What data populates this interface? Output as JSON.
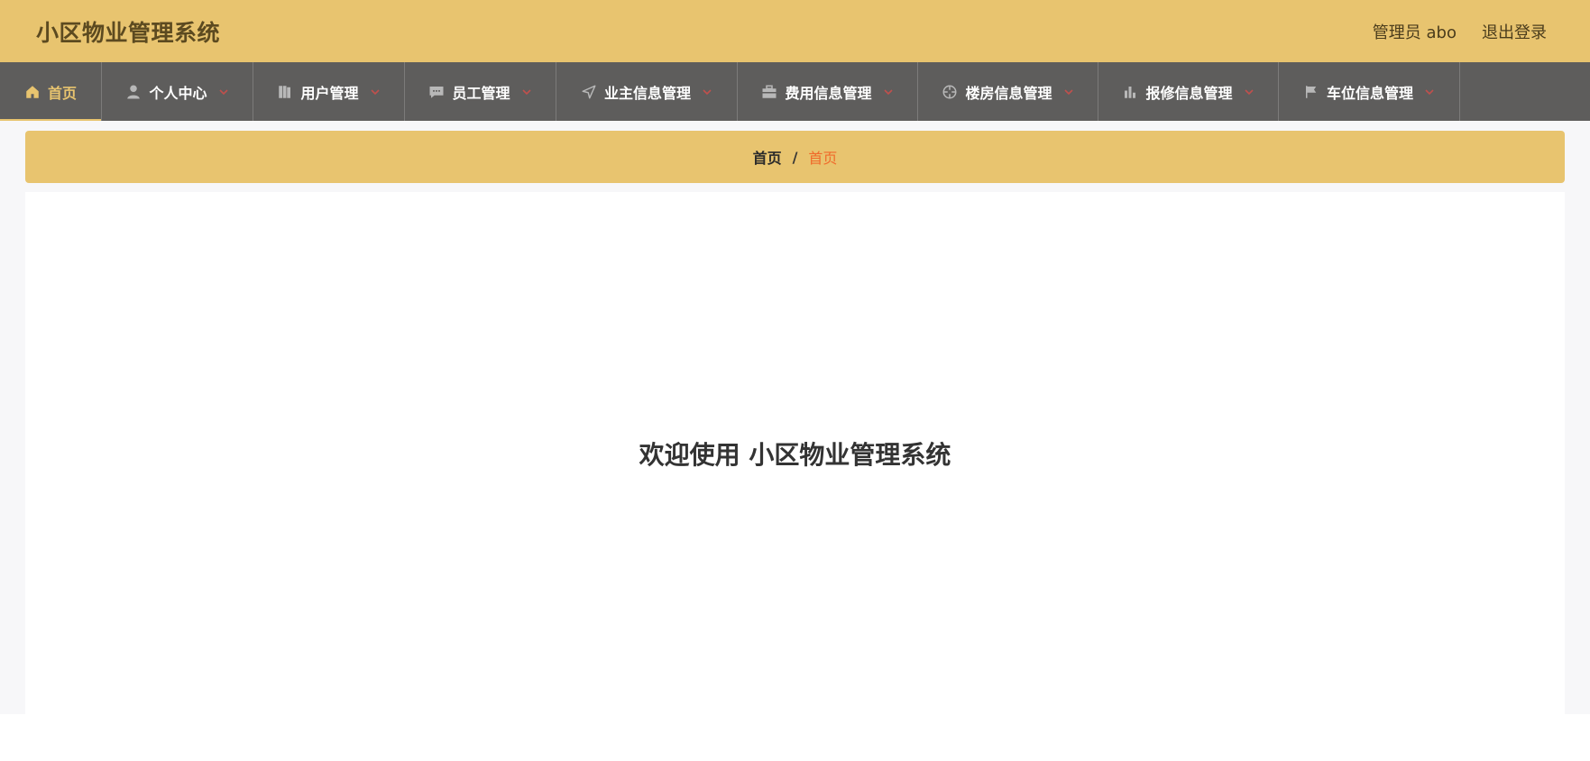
{
  "header": {
    "app_title": "小区物业管理系统",
    "user_label": "管理员 abo",
    "logout_label": "退出登录"
  },
  "nav": {
    "items": [
      {
        "label": "首页",
        "icon": "home-icon",
        "active": true
      },
      {
        "label": "个人中心",
        "icon": "user-icon"
      },
      {
        "label": "用户管理",
        "icon": "book-icon"
      },
      {
        "label": "员工管理",
        "icon": "chat-icon"
      },
      {
        "label": "业主信息管理",
        "icon": "navigation-icon"
      },
      {
        "label": "费用信息管理",
        "icon": "briefcase-icon"
      },
      {
        "label": "楼房信息管理",
        "icon": "crosshair-icon"
      },
      {
        "label": "报修信息管理",
        "icon": "bar-chart-icon"
      },
      {
        "label": "车位信息管理",
        "icon": "flag-icon"
      }
    ]
  },
  "breadcrumb": {
    "home": "首页",
    "separator": "/",
    "current": "首页"
  },
  "main": {
    "welcome": "欢迎使用 小区物业管理系统"
  },
  "colors": {
    "header_bg": "#e8c46f",
    "nav_bg": "#5e5d5c",
    "accent": "#f06a2a"
  }
}
